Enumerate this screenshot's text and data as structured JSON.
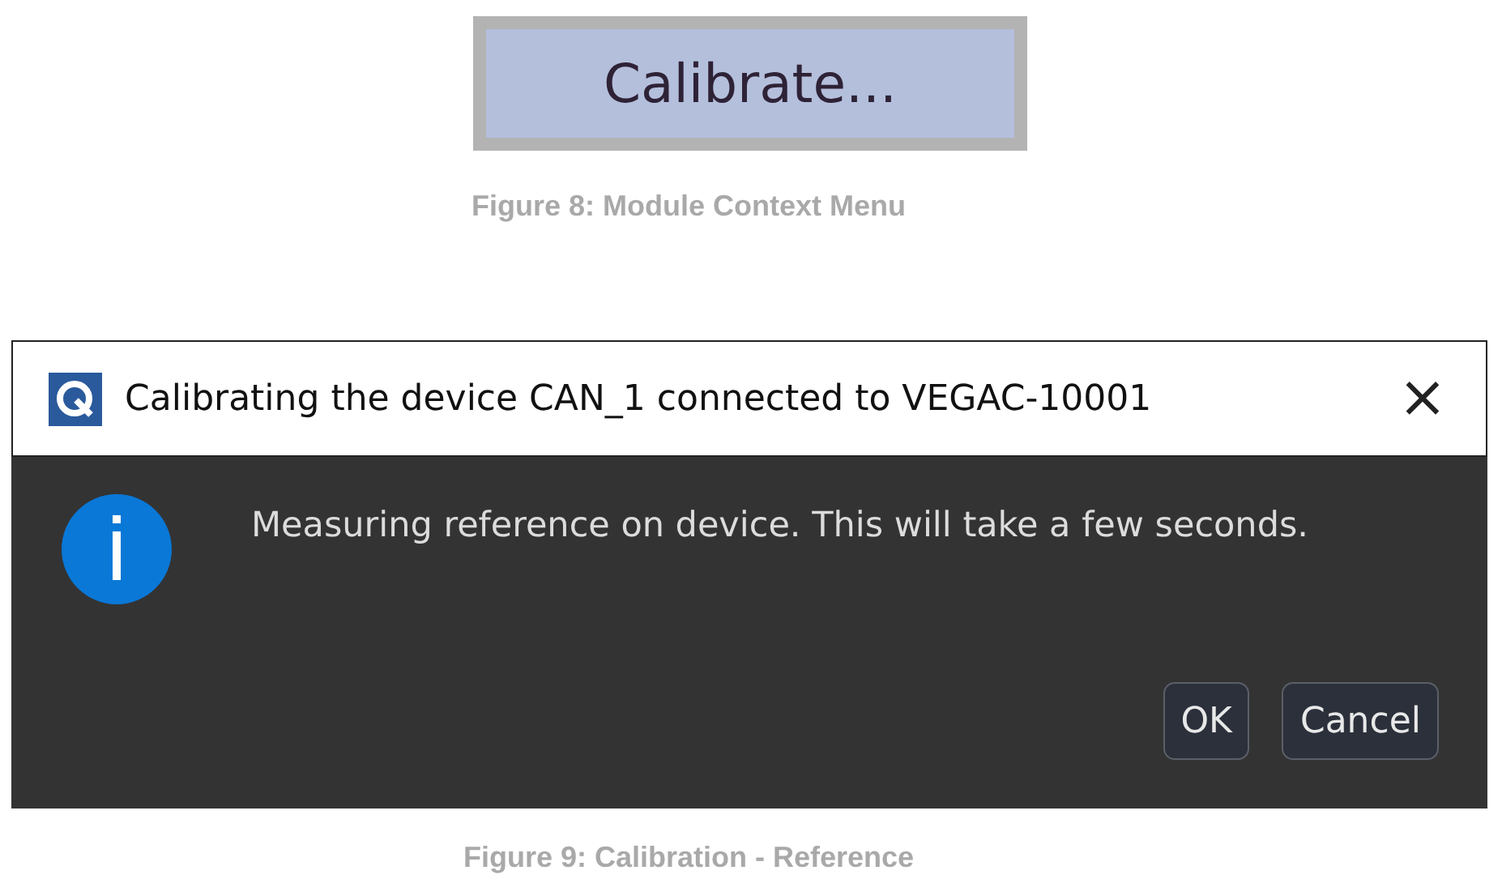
{
  "menu_item": {
    "label": "Calibrate..."
  },
  "figure_8_caption": "Figure 8: Module Context Menu",
  "dialog": {
    "title": "Calibrating the device CAN_1 connected to VEGAC-10001",
    "close": "×",
    "message": "Measuring reference on device. This will take a few seconds.",
    "buttons": [
      "OK",
      "Cancel"
    ]
  },
  "figure_9_caption": "Figure 9: Calibration - Reference"
}
